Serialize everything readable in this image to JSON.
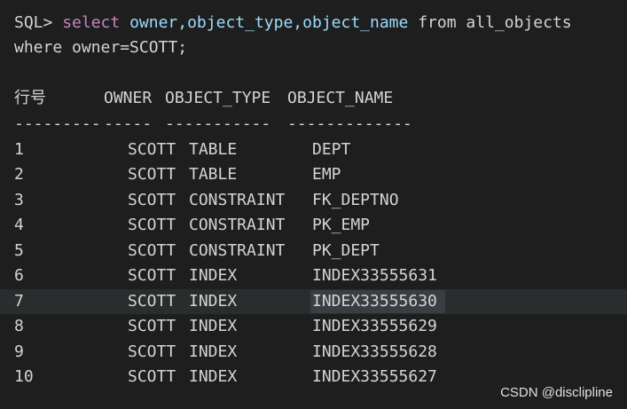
{
  "query": {
    "prompt": "SQL>",
    "keyword_select": "select",
    "columns": "owner,object_type,object_name",
    "keyword_from": "from",
    "table": "all_objects",
    "where_line": "where owner=SCOTT;"
  },
  "result": {
    "headers": {
      "rownum": "行号",
      "owner": "OWNER",
      "type": "OBJECT_TYPE",
      "name": "OBJECT_NAME"
    },
    "dashes": {
      "rownum": "---------",
      "owner": "-----",
      "type": "-----------",
      "name": "-------------"
    },
    "rows": [
      {
        "num": "1",
        "owner": "SCOTT",
        "type": "TABLE",
        "name": "DEPT"
      },
      {
        "num": "2",
        "owner": "SCOTT",
        "type": "TABLE",
        "name": "EMP"
      },
      {
        "num": "3",
        "owner": "SCOTT",
        "type": "CONSTRAINT",
        "name": "FK_DEPTNO"
      },
      {
        "num": "4",
        "owner": "SCOTT",
        "type": "CONSTRAINT",
        "name": "PK_EMP"
      },
      {
        "num": "5",
        "owner": "SCOTT",
        "type": "CONSTRAINT",
        "name": "PK_DEPT"
      },
      {
        "num": "6",
        "owner": "SCOTT",
        "type": "INDEX",
        "name": "INDEX33555631"
      },
      {
        "num": "7",
        "owner": "SCOTT",
        "type": "INDEX",
        "name": "INDEX33555630"
      },
      {
        "num": "8",
        "owner": "SCOTT",
        "type": "INDEX",
        "name": "INDEX33555629"
      },
      {
        "num": "9",
        "owner": "SCOTT",
        "type": "INDEX",
        "name": "INDEX33555628"
      },
      {
        "num": "10",
        "owner": "SCOTT",
        "type": "INDEX",
        "name": "INDEX33555627"
      }
    ]
  },
  "watermark": "CSDN @disclipline",
  "colors": {
    "background": "#1e1e1e",
    "keyword": "#c586c0",
    "identifier": "#9cdcfe",
    "text": "#d4d4d4"
  }
}
